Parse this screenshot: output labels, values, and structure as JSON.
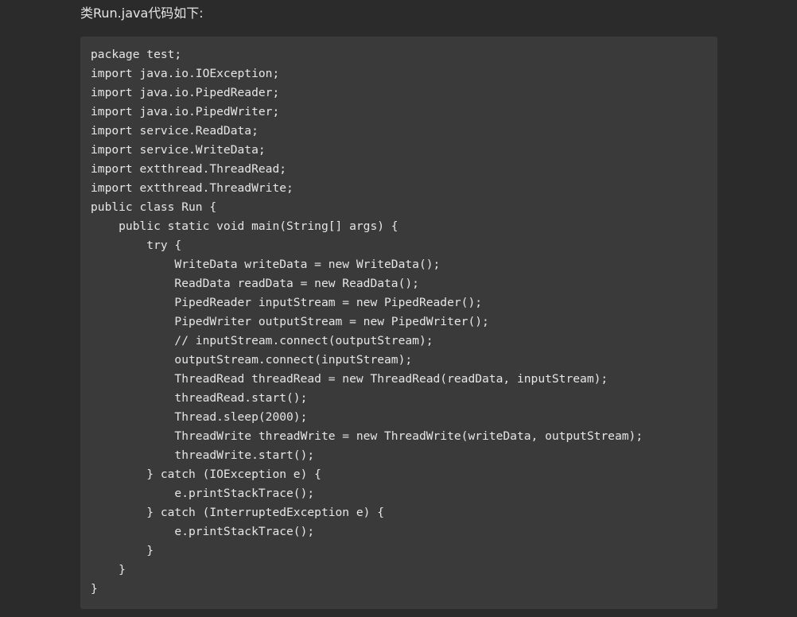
{
  "intro_text": "类Run.java代码如下:",
  "code": {
    "language": "java",
    "lines": [
      "package test;",
      "import java.io.IOException;",
      "import java.io.PipedReader;",
      "import java.io.PipedWriter;",
      "import service.ReadData;",
      "import service.WriteData;",
      "import extthread.ThreadRead;",
      "import extthread.ThreadWrite;",
      "public class Run {",
      "    public static void main(String[] args) {",
      "        try {",
      "            WriteData writeData = new WriteData();",
      "            ReadData readData = new ReadData();",
      "            PipedReader inputStream = new PipedReader();",
      "            PipedWriter outputStream = new PipedWriter();",
      "            // inputStream.connect(outputStream);",
      "            outputStream.connect(inputStream);",
      "            ThreadRead threadRead = new ThreadRead(readData, inputStream);",
      "            threadRead.start();",
      "            Thread.sleep(2000);",
      "            ThreadWrite threadWrite = new ThreadWrite(writeData, outputStream);",
      "            threadWrite.start();",
      "        } catch (IOException e) {",
      "            e.printStackTrace();",
      "        } catch (InterruptedException e) {",
      "            e.printStackTrace();",
      "        }",
      "    }",
      "}"
    ]
  }
}
